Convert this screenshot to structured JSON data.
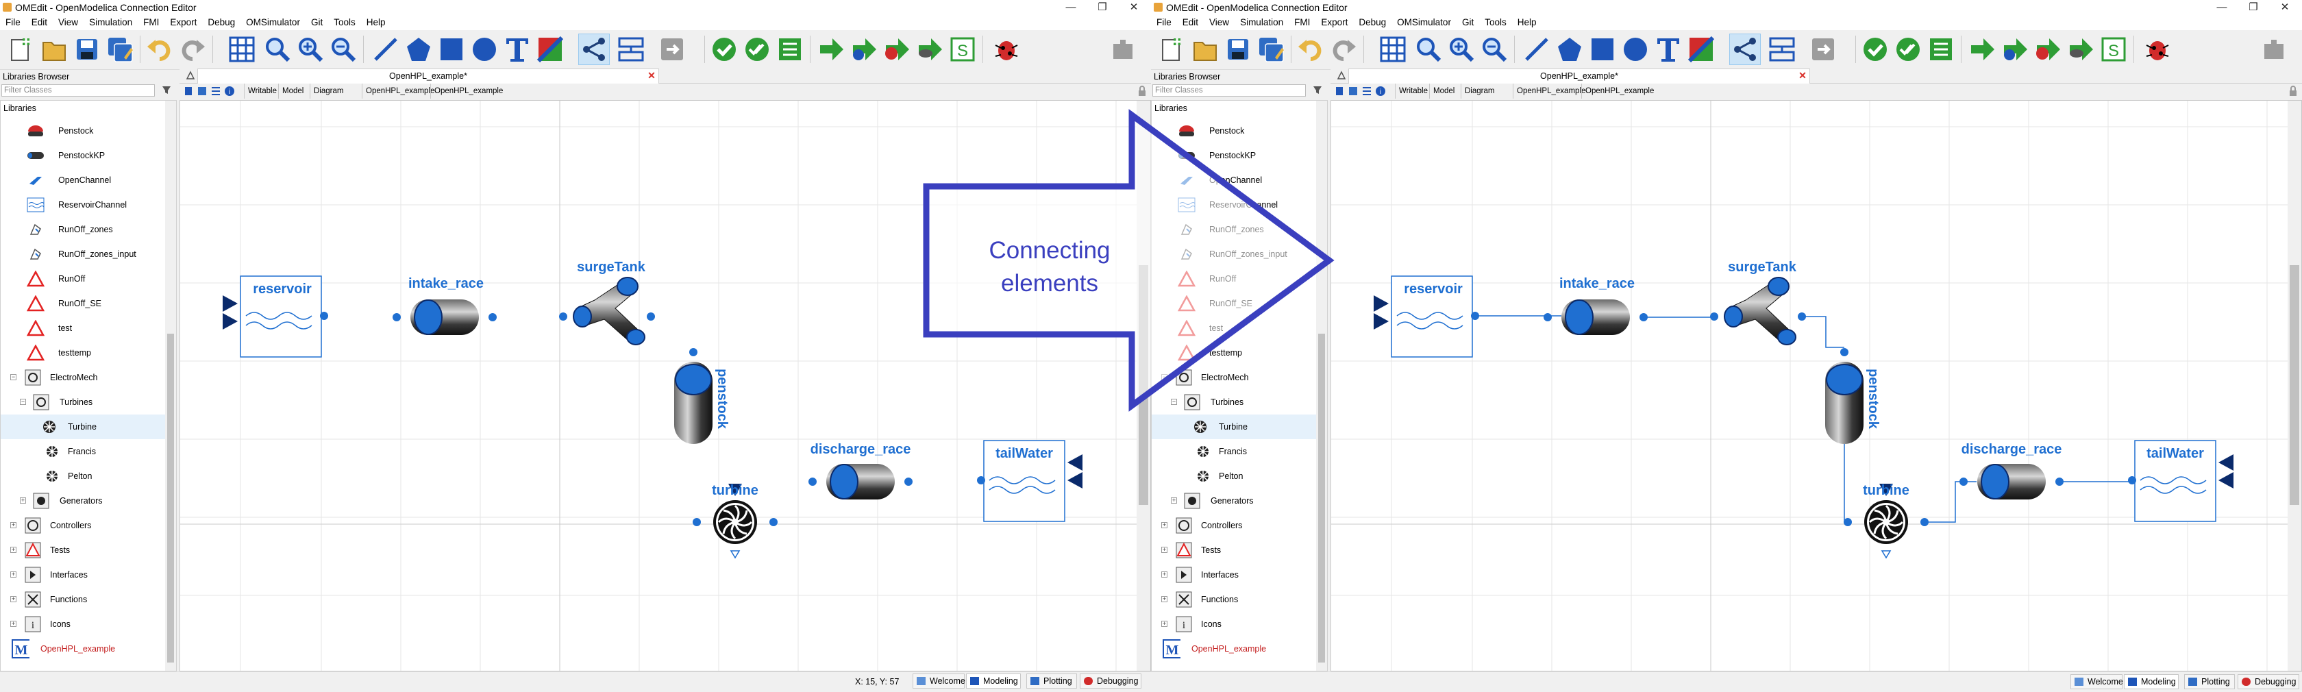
{
  "app": {
    "window_title": "OMEdit - OpenModelica Connection Editor",
    "menus": [
      "File",
      "Edit",
      "View",
      "Simulation",
      "FMI",
      "Export",
      "Debug",
      "OMSimulator",
      "Git",
      "Tools",
      "Help"
    ],
    "window_controls": {
      "minimize": "—",
      "maximize": "❐",
      "close": "✕"
    }
  },
  "libraries_browser": {
    "title": "Libraries Browser",
    "filter_placeholder": "Filter Classes",
    "root_label": "Libraries",
    "items": [
      {
        "label": "Penstock",
        "icon": "penstock-icon"
      },
      {
        "label": "PenstockKP",
        "icon": "penstock-kp-icon"
      },
      {
        "label": "OpenChannel",
        "icon": "open-channel-icon"
      },
      {
        "label": "ReservoirChannel",
        "icon": "reservoir-channel-icon"
      },
      {
        "label": "RunOff_zones",
        "icon": "runoff-zones-icon"
      },
      {
        "label": "RunOff_zones_input",
        "icon": "runoff-zones-input-icon"
      },
      {
        "label": "RunOff",
        "icon": "warning-triangle-icon"
      },
      {
        "label": "RunOff_SE",
        "icon": "warning-triangle-icon"
      },
      {
        "label": "test",
        "icon": "warning-triangle-icon"
      },
      {
        "label": "testtemp",
        "icon": "warning-triangle-icon"
      },
      {
        "label": "ElectroMech",
        "icon": "package-icon"
      },
      {
        "label": "Turbines",
        "icon": "package-icon"
      },
      {
        "label": "Turbine",
        "icon": "turbine-small-icon"
      },
      {
        "label": "Francis",
        "icon": "turbine-small-icon"
      },
      {
        "label": "Pelton",
        "icon": "turbine-small-icon"
      },
      {
        "label": "Generators",
        "icon": "package-icon"
      },
      {
        "label": "Controllers",
        "icon": "package-icon"
      },
      {
        "label": "Tests",
        "icon": "tests-icon"
      },
      {
        "label": "Interfaces",
        "icon": "interfaces-icon"
      },
      {
        "label": "Functions",
        "icon": "functions-icon"
      },
      {
        "label": "Icons",
        "icon": "info-icon"
      },
      {
        "label": "OpenHPL_example",
        "icon": "modelica-m-icon"
      }
    ]
  },
  "model_tab": {
    "label": "OpenHPL_example*",
    "toolbar_cells": [
      "Writable",
      "Model",
      "Diagram View",
      "OpenHPL_example",
      "OpenHPL_example"
    ]
  },
  "diagram": {
    "components": {
      "reservoir": "reservoir",
      "intake_race": "intake_race",
      "surgeTank": "surgeTank",
      "penstock": "penstock",
      "turbine": "turbine",
      "discharge_race": "discharge_race",
      "tailWater": "tailWater"
    },
    "component_color": "#1f6fd1"
  },
  "annotation": {
    "arrow_text_line1": "Connecting",
    "arrow_text_line2": "elements",
    "arrow_color": "#3a3fbf"
  },
  "statusbar": {
    "coords": "X: 15, Y: 57",
    "buttons": [
      "Welcome",
      "Modeling",
      "Plotting",
      "Debugging"
    ]
  }
}
